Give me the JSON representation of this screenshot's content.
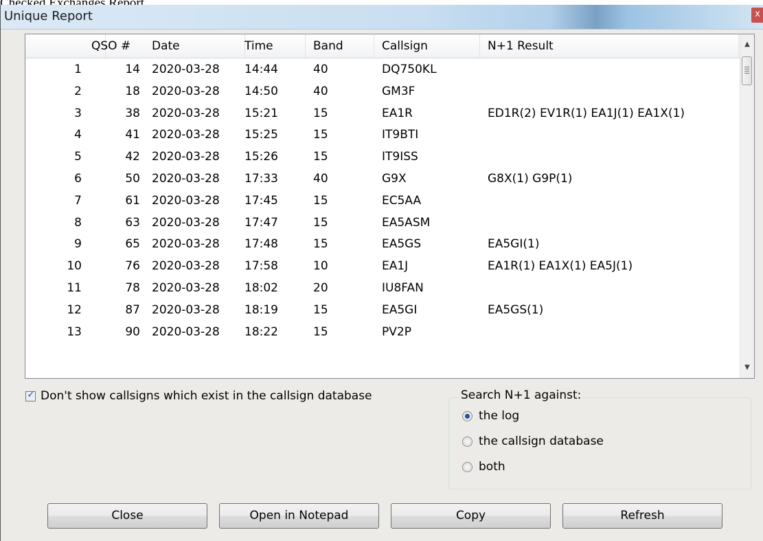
{
  "background_caption": "Checked Exchanges Report",
  "window": {
    "title": "Unique Report",
    "close_glyph": "x"
  },
  "table": {
    "columns": [
      "",
      "QSO #",
      "Date",
      "Time",
      "Band",
      "Callsign",
      "N+1 Result"
    ],
    "rows": [
      [
        "1",
        "14",
        "2020-03-28",
        "14:44",
        "40",
        "DQ750KL",
        ""
      ],
      [
        "2",
        "18",
        "2020-03-28",
        "14:50",
        "40",
        "GM3F",
        ""
      ],
      [
        "3",
        "38",
        "2020-03-28",
        "15:21",
        "15",
        "EA1R",
        "ED1R(2) EV1R(1) EA1J(1) EA1X(1)"
      ],
      [
        "4",
        "41",
        "2020-03-28",
        "15:25",
        "15",
        "IT9BTI",
        ""
      ],
      [
        "5",
        "42",
        "2020-03-28",
        "15:26",
        "15",
        "IT9ISS",
        ""
      ],
      [
        "6",
        "50",
        "2020-03-28",
        "17:33",
        "40",
        "G9X",
        "G8X(1) G9P(1)"
      ],
      [
        "7",
        "61",
        "2020-03-28",
        "17:45",
        "15",
        "EC5AA",
        ""
      ],
      [
        "8",
        "63",
        "2020-03-28",
        "17:47",
        "15",
        "EA5ASM",
        ""
      ],
      [
        "9",
        "65",
        "2020-03-28",
        "17:48",
        "15",
        "EA5GS",
        "EA5GI(1)"
      ],
      [
        "10",
        "76",
        "2020-03-28",
        "17:58",
        "10",
        "EA1J",
        "EA1R(1) EA1X(1) EA5J(1)"
      ],
      [
        "11",
        "78",
        "2020-03-28",
        "18:02",
        "20",
        "IU8FAN",
        ""
      ],
      [
        "12",
        "87",
        "2020-03-28",
        "18:19",
        "15",
        "EA5GI",
        "EA5GS(1)"
      ],
      [
        "13",
        "90",
        "2020-03-28",
        "18:22",
        "15",
        "PV2P",
        ""
      ]
    ]
  },
  "options": {
    "hide_known_callsigns": {
      "label": "Don't show callsigns which exist in the callsign database",
      "checked": true
    },
    "search_group": {
      "title": "Search N+1 against:",
      "choices": [
        "the log",
        "the callsign database",
        "both"
      ],
      "selected": "the log"
    }
  },
  "buttons": {
    "close": "Close",
    "open_notepad": "Open in Notepad",
    "copy": "Copy",
    "refresh": "Refresh"
  },
  "icons": {
    "check": "check-icon",
    "scroll_up": "arrow-up-icon",
    "scroll_down": "arrow-down-icon"
  },
  "colors": {
    "title_bar": "#c9def1",
    "selected_radio": "#1f4f9e",
    "close_button": "#c75050"
  }
}
